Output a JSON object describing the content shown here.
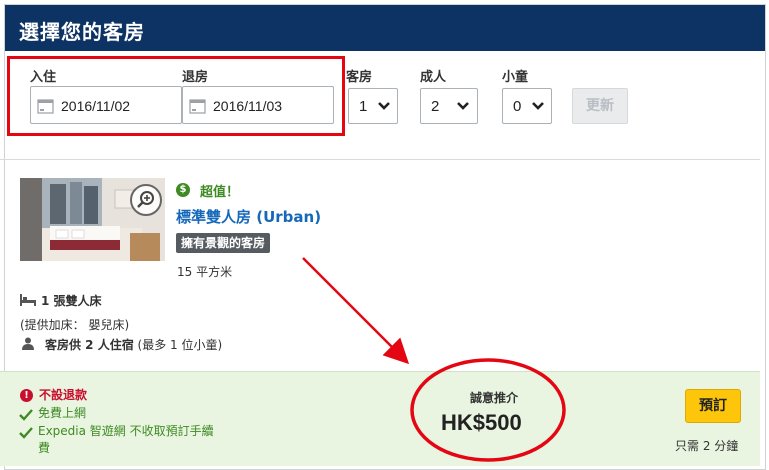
{
  "header": {
    "title": "選擇您的客房"
  },
  "search": {
    "checkin_label": "入住",
    "checkin_value": "2016/11/02",
    "checkout_label": "退房",
    "checkout_value": "2016/11/03",
    "rooms_label": "客房",
    "rooms_value": "1",
    "adults_label": "成人",
    "adults_value": "2",
    "children_label": "小童",
    "children_value": "0",
    "update_label": "更新"
  },
  "room": {
    "deal_icon": "$",
    "deal_text": "超值！",
    "name": "標準雙人房 (Urban)",
    "view_badge": "擁有景觀的客房",
    "size": "15 平方米",
    "bed": "1 張雙人床",
    "extra_bed": "(提供加床： 嬰兒床)",
    "occupancy_bold": "客房供 2 人住宿",
    "occupancy_note": " (最多 1 位小童)"
  },
  "rate": {
    "non_refundable": "不設退款",
    "benefit_1": "免費上網",
    "benefit_2": "Expedia 智遊網 不收取預訂手續費",
    "price_label": "誠意推介",
    "price": "HK$500",
    "book_label": "預訂",
    "booking_time": "只需 2 分鐘"
  },
  "colors": {
    "header_bg": "#0c3363",
    "deal_green": "#3f8a24",
    "link_blue": "#1668b8",
    "alert_red": "#c8102e",
    "book_yellow": "#fdc60a",
    "annotation_red": "#e40613"
  },
  "icons": {
    "date": "calendar-icon",
    "dropdown": "chevron-down-icon",
    "zoom": "zoom-in-icon",
    "bed": "bed-icon",
    "person": "person-icon",
    "benefit": "check-icon",
    "alert": "exclamation-icon"
  }
}
